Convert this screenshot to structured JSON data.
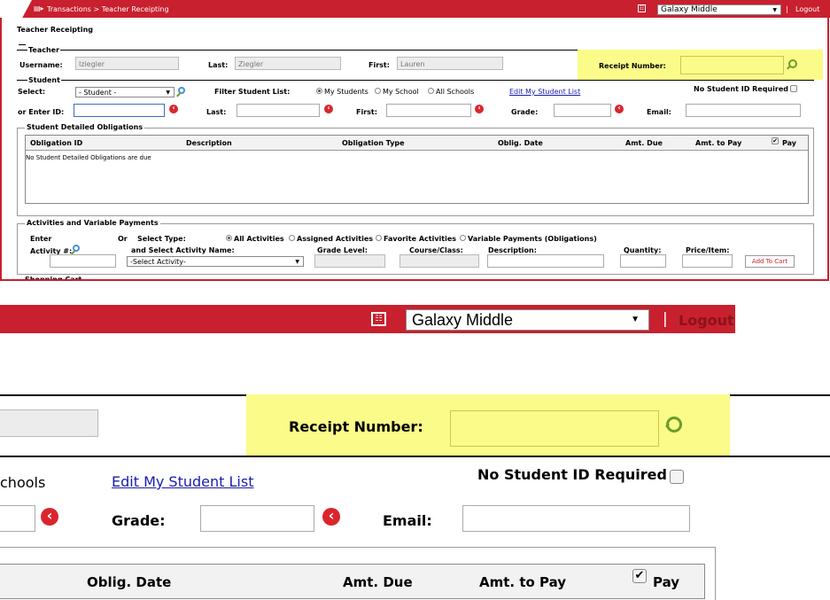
{
  "topbar": {
    "breadcrumb": "Transactions > Teacher Receipting",
    "school_selected": "Galaxy Middle",
    "logout": "Logout",
    "separator": "|"
  },
  "page_title": "Teacher Receipting",
  "teacher": {
    "legend": "Teacher",
    "username_label": "Username:",
    "username_value": "lziegler",
    "last_label": "Last:",
    "last_value": "Ziegler",
    "first_label": "First:",
    "first_value": "Lauren",
    "receipt_label": "Receipt Number:",
    "receipt_value": ""
  },
  "student": {
    "legend": "Student",
    "select_label": "Select:",
    "select_value": "- Student -",
    "filter_label": "Filter Student List:",
    "filter_options": [
      "My Students",
      "My School",
      "All Schools"
    ],
    "edit_link": "Edit My Student List",
    "no_id_label": "No Student ID Required",
    "enter_id_label": "or Enter ID:",
    "last_label": "Last:",
    "first_label": "First:",
    "grade_label": "Grade:",
    "email_label": "Email:"
  },
  "obligations": {
    "legend": "Student Detailed Obligations",
    "columns": [
      "Obligation ID",
      "Description",
      "Obligation Type",
      "Oblig. Date",
      "Amt. Due",
      "Amt. to Pay",
      "Pay"
    ],
    "empty_message": "No Student Detailed Obligations are due"
  },
  "activities": {
    "legend": "Activities and Variable Payments",
    "enter_label": "Enter",
    "activity_label": "Activity #:",
    "or_label": "Or",
    "select_type_label": "Select Type:",
    "type_options": [
      "All Activities",
      "Assigned Activities",
      "Favorite Activities",
      "Variable Payments (Obligations)"
    ],
    "select_activity_label": "and Select Activity Name:",
    "activity_select_value": "-Select Activity-",
    "grade_level_label": "Grade Level:",
    "course_label": "Course/Class:",
    "description_label": "Description:",
    "quantity_label": "Quantity:",
    "price_label": "Price/Item:",
    "add_to_cart": "Add To Cart"
  },
  "cart_legend": "Shopping Cart",
  "zoom": {
    "school_selected": "Galaxy Middle",
    "separator": "|",
    "logout": "Logout",
    "receipt_label": "Receipt Number:",
    "schools_fragment": "chools",
    "edit_link": "Edit My Student List",
    "no_id_label": "No Student ID Required",
    "grade_label": "Grade:",
    "email_label": "Email:",
    "columns": [
      "Oblig. Date",
      "Amt. Due",
      "Amt. to Pay",
      "Pay"
    ]
  },
  "colors": {
    "topbar": "#c8202e",
    "highlight": "#fbfb8a",
    "link": "#1a1ab0"
  }
}
